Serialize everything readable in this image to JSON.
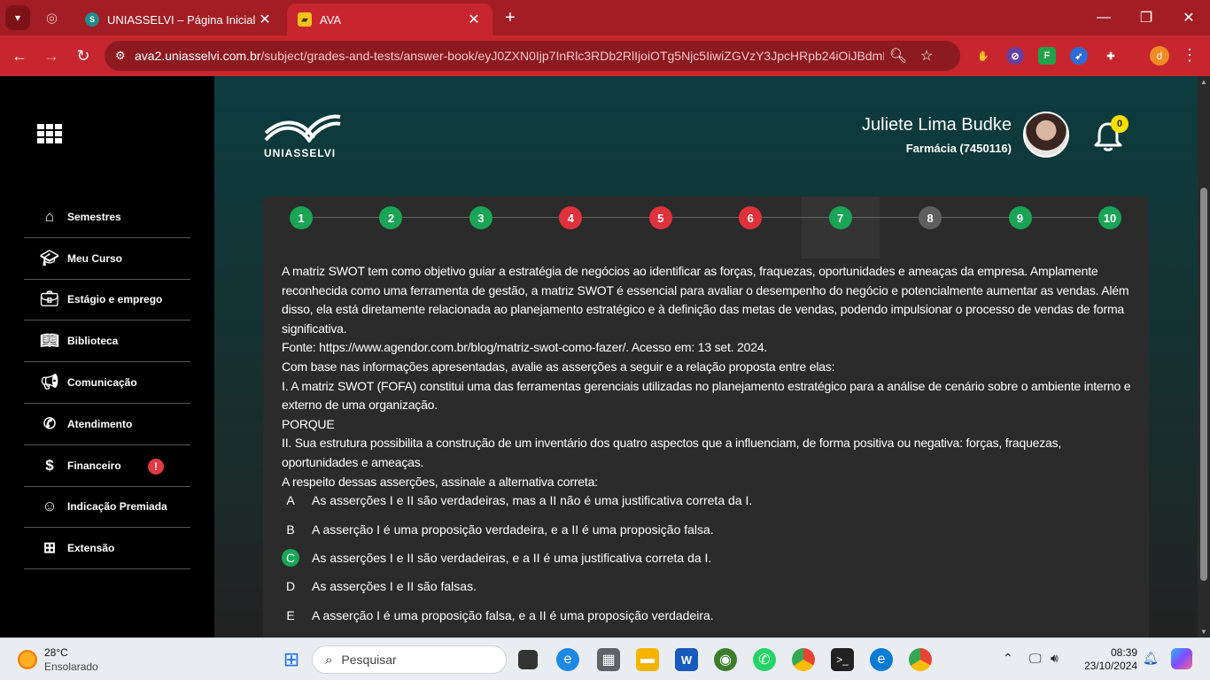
{
  "browser": {
    "tabs": [
      {
        "title": "UNIASSELVI – Página Inicial",
        "favicon": "S",
        "active": false
      },
      {
        "title": "AVA",
        "favicon": "AVA",
        "active": true
      }
    ],
    "url_host": "ava2.uniasselvi.com.br",
    "url_path": "/subject/grades-and-tests/answer-book/eyJ0ZXN0Ijp7InRlc3RDb2RlIjoiOTg5Njc5IiwiZGVzY3JpcHRpb24iOiJBdmFs...",
    "profile_initial": "d",
    "extensions": [
      {
        "name": "hand-icon",
        "color": "#c7262e"
      },
      {
        "name": "compass-icon",
        "color": "#6b3fa0"
      },
      {
        "name": "f-extension-icon",
        "label": "F",
        "color": "#21a34a"
      },
      {
        "name": "rocket-icon",
        "color": "#2d6bd6"
      },
      {
        "name": "puzzle-icon",
        "color": "#c7262e"
      }
    ]
  },
  "sidebar": {
    "items": [
      {
        "label": "Semestres",
        "icon": "home-icon"
      },
      {
        "label": "Meu Curso",
        "icon": "graduation-cap-icon"
      },
      {
        "label": "Estágio e emprego",
        "icon": "briefcase-icon"
      },
      {
        "label": "Biblioteca",
        "icon": "book-icon"
      },
      {
        "label": "Comunicação",
        "icon": "megaphone-icon"
      },
      {
        "label": "Atendimento",
        "icon": "phone-icon"
      },
      {
        "label": "Financeiro",
        "icon": "dollar-icon",
        "badge": "!"
      },
      {
        "label": "Indicação Premiada",
        "icon": "people-icon"
      },
      {
        "label": "Extensão",
        "icon": "extension-icon"
      }
    ]
  },
  "header": {
    "logo_text": "UNIASSELVI",
    "user_name": "Juliete Lima Budke",
    "user_course": "Farmácia (7450116)",
    "notifications_count": "0"
  },
  "steps": [
    {
      "n": "1",
      "status": "correct",
      "color": "#1aa456"
    },
    {
      "n": "2",
      "status": "correct",
      "color": "#1aa456"
    },
    {
      "n": "3",
      "status": "correct",
      "color": "#1aa456"
    },
    {
      "n": "4",
      "status": "wrong",
      "color": "#e0323c"
    },
    {
      "n": "5",
      "status": "wrong",
      "color": "#e0323c"
    },
    {
      "n": "6",
      "status": "wrong",
      "color": "#e0323c"
    },
    {
      "n": "7",
      "status": "correct",
      "color": "#1aa456",
      "current": true
    },
    {
      "n": "8",
      "status": "unanswered",
      "color": "#5f5f5f"
    },
    {
      "n": "9",
      "status": "correct",
      "color": "#1aa456"
    },
    {
      "n": "10",
      "status": "correct",
      "color": "#1aa456"
    }
  ],
  "question": {
    "paragraphs": [
      "A matriz SWOT tem como objetivo guiar a estratégia de negócios ao identificar as forças, fraquezas, oportunidades e ameaças da empresa. Amplamente reconhecida como uma ferramenta de gestão, a matriz SWOT é essencial para avaliar o desempenho do negócio e potencialmente aumentar as vendas. Além disso, ela está diretamente relacionada ao planejamento estratégico e à definição das metas de vendas, podendo impulsionar o processo de vendas de forma significativa.",
      "Fonte: https://www.agendor.com.br/blog/matriz-swot-como-fazer/. Acesso em: 13 set. 2024.",
      "Com base nas informações apresentadas, avalie as asserções a seguir e a relação proposta entre elas:",
      "I. A matriz SWOT (FOFA) constitui uma das ferramentas gerenciais utilizadas no planejamento estratégico para a análise de cenário sobre o ambiente interno e externo de uma organização.",
      "PORQUE",
      "II. Sua estrutura possibilita a construção de um inventário dos quatro aspectos que a influenciam, de forma positiva ou negativa: forças, fraquezas, oportunidades e ameaças.",
      "A respeito dessas asserções, assinale a alternativa correta:"
    ],
    "options": [
      {
        "letter": "A",
        "text": "As asserções I e II são verdadeiras, mas a II não é uma justificativa correta da I.",
        "selected": false
      },
      {
        "letter": "B",
        "text": "A asserção I é uma proposição verdadeira, e a II é uma proposição falsa.",
        "selected": false
      },
      {
        "letter": "C",
        "text": "As asserções I e II são verdadeiras, e a II é uma justificativa correta da I.",
        "selected": true
      },
      {
        "letter": "D",
        "text": "As asserções I e II são falsas.",
        "selected": false
      },
      {
        "letter": "E",
        "text": "A asserção I é uma proposição falsa, e a II é uma proposição verdadeira.",
        "selected": false
      }
    ]
  },
  "taskbar": {
    "temperature": "28°C",
    "weather": "Ensolarado",
    "search_placeholder": "Pesquisar",
    "time": "08:39",
    "date": "23/10/2024"
  }
}
